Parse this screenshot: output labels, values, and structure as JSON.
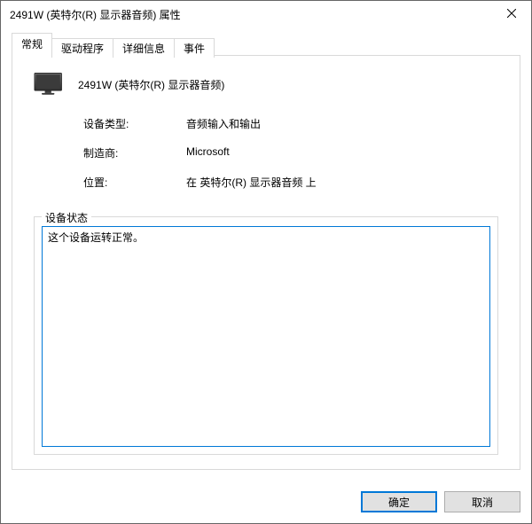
{
  "window": {
    "title": "2491W (英特尔(R) 显示器音频) 属性"
  },
  "tabs": [
    {
      "label": "常规",
      "active": true
    },
    {
      "label": "驱动程序",
      "active": false
    },
    {
      "label": "详细信息",
      "active": false
    },
    {
      "label": "事件",
      "active": false
    }
  ],
  "general": {
    "device_name": "2491W (英特尔(R) 显示器音频)",
    "rows": {
      "device_type_label": "设备类型:",
      "device_type_value": "音频输入和输出",
      "manufacturer_label": "制造商:",
      "manufacturer_value": "Microsoft",
      "location_label": "位置:",
      "location_value": "在 英特尔(R) 显示器音频 上"
    },
    "status_group_label": "设备状态",
    "status_text": "这个设备运转正常。"
  },
  "buttons": {
    "ok": "确定",
    "cancel": "取消"
  }
}
